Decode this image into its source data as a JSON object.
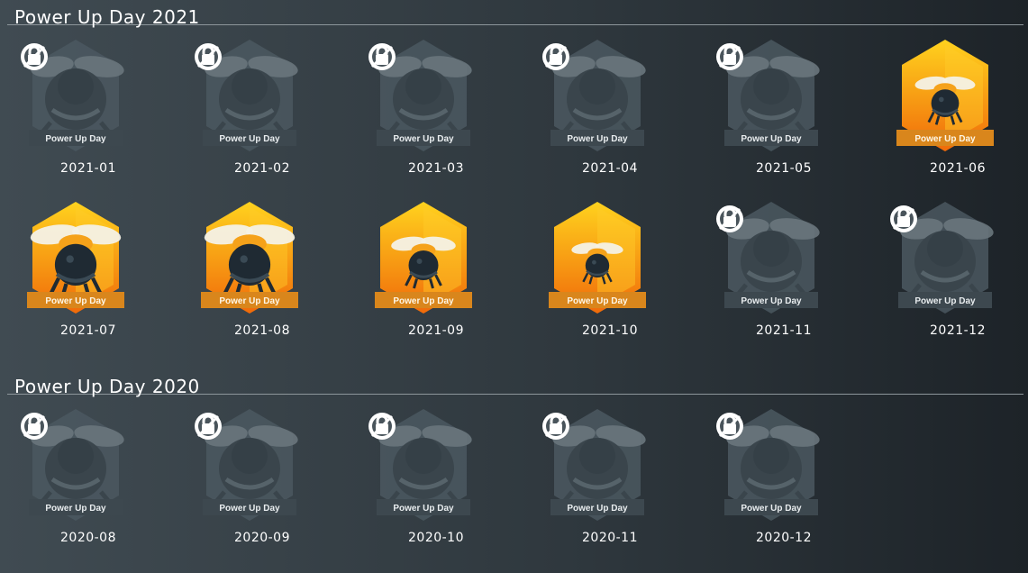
{
  "sections": [
    {
      "title": "Power Up Day 2021",
      "badges": [
        {
          "label": "2021-01",
          "locked": true
        },
        {
          "label": "2021-02",
          "locked": true
        },
        {
          "label": "2021-03",
          "locked": true
        },
        {
          "label": "2021-04",
          "locked": true
        },
        {
          "label": "2021-05",
          "locked": true
        },
        {
          "label": "2021-06",
          "locked": false
        },
        {
          "label": "2021-07",
          "locked": false
        },
        {
          "label": "2021-08",
          "locked": false
        },
        {
          "label": "2021-09",
          "locked": false
        },
        {
          "label": "2021-10",
          "locked": false
        },
        {
          "label": "2021-11",
          "locked": true
        },
        {
          "label": "2021-12",
          "locked": true
        }
      ]
    },
    {
      "title": "Power Up Day 2020",
      "badges": [
        {
          "label": "2020-08",
          "locked": true
        },
        {
          "label": "2020-09",
          "locked": true
        },
        {
          "label": "2020-10",
          "locked": true
        },
        {
          "label": "2020-11",
          "locked": true
        },
        {
          "label": "2020-12",
          "locked": true
        }
      ]
    }
  ],
  "badge_banner_text": "Power Up Day",
  "colors": {
    "gold_top": "#ffd21e",
    "gold_bottom": "#f06a0a",
    "banner": "#d9861c",
    "locked": "#4b5860"
  },
  "icons": {
    "locked": "lock-icon",
    "badge": "bee-icon"
  }
}
